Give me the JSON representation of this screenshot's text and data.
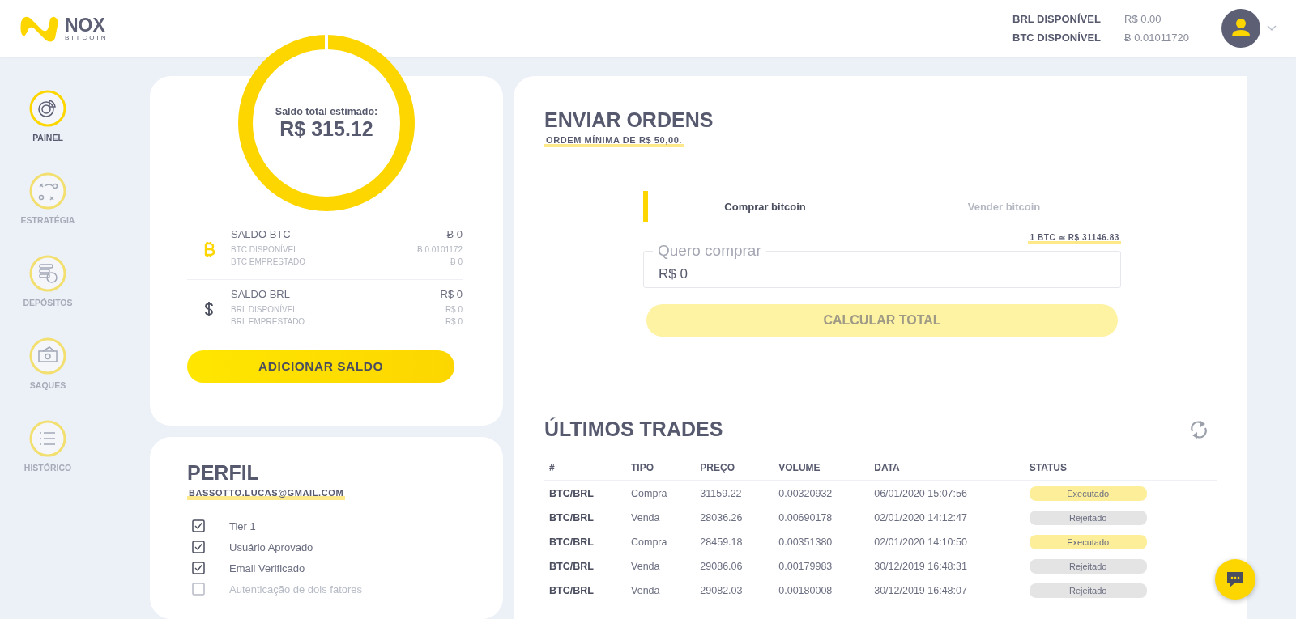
{
  "header": {
    "logo": {
      "name": "NOX",
      "sub": "BITCOIN"
    },
    "balances": [
      {
        "label": "BRL DISPONÍVEL",
        "value": "R$ 0.00"
      },
      {
        "label": "BTC DISPONÍVEL",
        "value": "Ƀ 0.01011720"
      }
    ]
  },
  "sidebar": {
    "items": [
      {
        "label": "PAINEL",
        "kind": "panel",
        "selected": true
      },
      {
        "label": "ESTRATÉGIA",
        "kind": "strategy",
        "selected": false
      },
      {
        "label": "DEPÓSITOS",
        "kind": "deposits",
        "selected": false
      },
      {
        "label": "SAQUES",
        "kind": "withdrawals",
        "selected": false
      },
      {
        "label": "HISTÓRICO",
        "kind": "history",
        "selected": false
      }
    ]
  },
  "balance_card": {
    "total_label": "Saldo total estimado:",
    "total_value": "R$ 315.12",
    "groups": [
      {
        "kind": "btc",
        "title": "SALDO BTC",
        "total": "Ƀ 0",
        "lines": [
          {
            "label": "BTC DISPONÍVEL",
            "value": "Ƀ 0.0101172"
          },
          {
            "label": "BTC EMPRESTADO",
            "value": "Ƀ 0"
          }
        ]
      },
      {
        "kind": "brl",
        "title": "SALDO BRL",
        "total": "R$ 0",
        "lines": [
          {
            "label": "BRL DISPONÍVEL",
            "value": "R$ 0"
          },
          {
            "label": "BRL EMPRESTADO",
            "value": "R$ 0"
          }
        ]
      }
    ],
    "button": "ADICIONAR SALDO"
  },
  "profile": {
    "title": "PERFIL",
    "email": "BASSOTTO.LUCAS@GMAIL.COM",
    "checks": [
      {
        "label": "Tier 1",
        "checked": true
      },
      {
        "label": "Usuário Aprovado",
        "checked": true
      },
      {
        "label": "Email Verificado",
        "checked": true
      },
      {
        "label": "Autenticação de dois fatores",
        "checked": false
      }
    ]
  },
  "orders": {
    "title": "ENVIAR ORDENS",
    "subtitle": "ORDEM MÍNIMA DE R$ 50,00.",
    "tabs": [
      {
        "label": "Comprar bitcoin",
        "selected": true
      },
      {
        "label": "Vender bitcoin",
        "selected": false
      }
    ],
    "rate": "1 BTC ≃ R$ 31146.83",
    "field": {
      "label": "Quero comprar",
      "value": "R$ 0"
    },
    "button": {
      "label": "CALCULAR TOTAL",
      "disabled": true
    }
  },
  "trades": {
    "title": "ÚLTIMOS TRADES",
    "columns": [
      "#",
      "TIPO",
      "PREÇO",
      "VOLUME",
      "DATA",
      "STATUS"
    ],
    "rows": [
      {
        "pair": "BTC/BRL",
        "type": "Compra",
        "price": "31159.22",
        "volume": "0.00320932",
        "date": "06/01/2020 15:07:56",
        "status": "Executado",
        "kind": "executed"
      },
      {
        "pair": "BTC/BRL",
        "type": "Venda",
        "price": "28036.26",
        "volume": "0.00690178",
        "date": "02/01/2020 14:12:47",
        "status": "Rejeitado",
        "kind": "rejected"
      },
      {
        "pair": "BTC/BRL",
        "type": "Compra",
        "price": "28459.18",
        "volume": "0.00351380",
        "date": "02/01/2020 14:10:50",
        "status": "Executado",
        "kind": "executed"
      },
      {
        "pair": "BTC/BRL",
        "type": "Venda",
        "price": "29086.06",
        "volume": "0.00179983",
        "date": "30/12/2019 16:48:31",
        "status": "Rejeitado",
        "kind": "rejected"
      },
      {
        "pair": "BTC/BRL",
        "type": "Venda",
        "price": "29082.03",
        "volume": "0.00180008",
        "date": "30/12/2019 16:48:07",
        "status": "Rejeitado",
        "kind": "rejected"
      }
    ]
  }
}
